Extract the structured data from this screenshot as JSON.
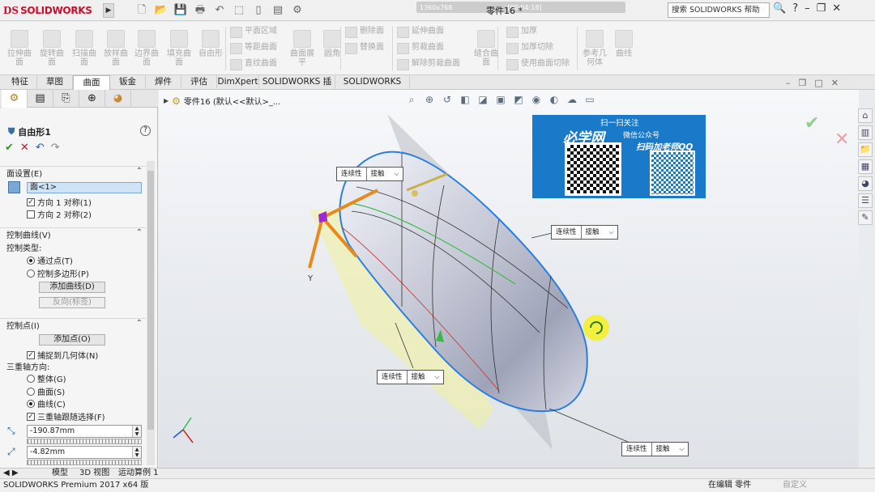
{
  "titlebar": {
    "brand_ds": "DS",
    "brand_name": "SOLIDWORKS",
    "recording": "1360x768",
    "recording_time": "[00:04:18]",
    "doc_title": "零件16 *",
    "search_placeholder": "搜索 SOLIDWORKS 帮助"
  },
  "ribbon": {
    "big_buttons": [
      "拉伸曲面",
      "旋转曲面",
      "扫描曲面",
      "放样曲面",
      "边界曲面",
      "填充曲面",
      "自由形"
    ],
    "col1": [
      "平面区域",
      "等距曲面",
      "直纹曲面"
    ],
    "mid_buttons": [
      "曲面展平",
      "圆角"
    ],
    "col2": [
      "删除面",
      "替换面"
    ],
    "col3": [
      "延伸曲面",
      "剪裁曲面",
      "解除剪裁曲面"
    ],
    "knit": "缝合曲面",
    "col4": [
      "加厚",
      "加厚切除",
      "使用曲面切除"
    ],
    "ref_geom": "参考几何体",
    "curves": "曲线"
  },
  "tabs": [
    "特征",
    "草图",
    "曲面",
    "钣金",
    "焊件",
    "评估",
    "DimXpert",
    "SOLIDWORKS 插件",
    "SOLIDWORKS MBD"
  ],
  "active_tab": "曲面",
  "panel": {
    "feature": "自由形1",
    "face_settings": "面设置(E)",
    "face_item": "面<1>",
    "dir1": "方向 1 对称(1)",
    "dir2": "方向 2 对称(2)",
    "control_curves": "控制曲线(V)",
    "control_type": "控制类型:",
    "through_pts": "通过点(T)",
    "ctrl_poly": "控制多边形(P)",
    "add_curve": "添加曲线(D)",
    "flip": "反向(标签)",
    "control_points": "控制点(I)",
    "add_point": "添加点(O)",
    "snap": "捕捉到几何体(N)",
    "triad_dir": "三重轴方向:",
    "global": "整体(G)",
    "surface": "曲面(S)",
    "curve": "曲线(C)",
    "triad_follow": "三重轴跟随选择(F)",
    "val1": "-190.87mm",
    "val2": "-4.82mm"
  },
  "viewport": {
    "breadcrumb": "零件16 (默认<<默认>_...",
    "callout_key": "连续性",
    "callout_val": "接触",
    "axis_label_y": "Y",
    "promo_scan": "扫一扫关注",
    "promo_brand": "必学网",
    "promo_wechat": "微信公众号",
    "promo_qq": "扫码加老师QQ"
  },
  "bottom_tabs": [
    "模型",
    "3D 视图",
    "运动算例 1"
  ],
  "status": {
    "left": "SOLIDWORKS Premium 2017 x64 版",
    "editing": "在编辑 零件",
    "custom": "自定义"
  },
  "colors": {
    "brand_red": "#c8102e",
    "accent_blue": "#1a79c9",
    "ok_green": "#2a9a2a",
    "edge_blue": "#2b7de1"
  }
}
